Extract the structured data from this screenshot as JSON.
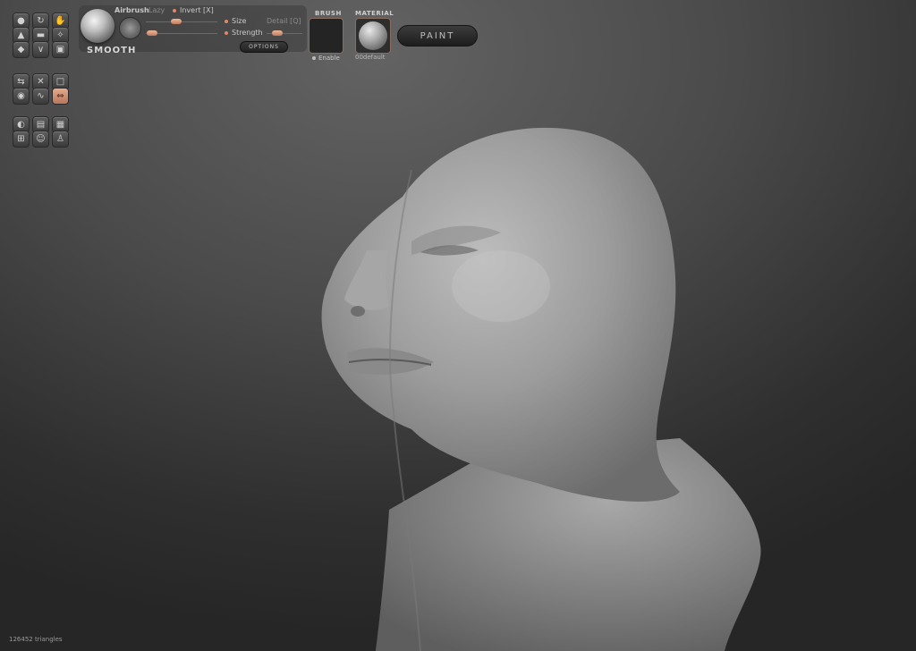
{
  "toolbar": {
    "rows": [
      [
        "brush-standard-icon",
        "rotate-icon",
        "grab-icon"
      ],
      [
        "inflate-icon",
        "flatten-icon",
        "pinch-icon"
      ],
      [
        "smooth-icon",
        "crease-icon",
        "layer-icon"
      ],
      [
        "symmetry-icon",
        "mask-icon",
        "frame-icon"
      ],
      [
        "wireframe-icon",
        "snake-icon",
        "mirror-icon"
      ],
      [
        "light-icon",
        "capture-icon",
        "camera-icon"
      ],
      [
        "subdivide-icon",
        "head-icon",
        "body-icon"
      ]
    ],
    "active": "mirror-icon"
  },
  "brush": {
    "name": "SMOOTH",
    "airbrush_label": "Airbrush",
    "lazy_label": "Lazy",
    "invert_label": "Invert [X]",
    "size_label": "Size",
    "detail_label": "Detail [Q]",
    "strength_label": "Strength",
    "options_label": "OPTIONS"
  },
  "brush_section": {
    "title": "BRUSH",
    "enable_label": "Enable"
  },
  "material_section": {
    "title": "MATERIAL",
    "name": "00default"
  },
  "paint_button": "PAINT",
  "status": {
    "triangles": "126452 triangles"
  },
  "colors": {
    "accent": "#e0876a",
    "background_top": "#636363",
    "background_bottom": "#262626"
  }
}
